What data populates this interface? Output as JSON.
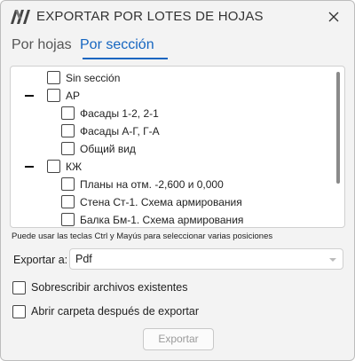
{
  "window": {
    "title": "EXPORTAR POR LOTES DE HOJAS"
  },
  "tabs": [
    {
      "label": "Por hojas",
      "active": false
    },
    {
      "label": "Por sección",
      "active": true
    }
  ],
  "tree": {
    "rows": [
      {
        "label": "Sin sección",
        "level": 1,
        "collapsible": false,
        "checked": false
      },
      {
        "label": "АР",
        "level": 1,
        "collapsible": true,
        "expanded": true,
        "checked": false
      },
      {
        "label": "Фасады 1-2, 2-1",
        "level": 2,
        "collapsible": false,
        "checked": false
      },
      {
        "label": "Фасады А-Г, Г-А",
        "level": 2,
        "collapsible": false,
        "checked": false
      },
      {
        "label": "Общий вид",
        "level": 2,
        "collapsible": false,
        "checked": false
      },
      {
        "label": "КЖ",
        "level": 1,
        "collapsible": true,
        "expanded": true,
        "checked": false
      },
      {
        "label": "Планы на отм. -2,600 и 0,000",
        "level": 2,
        "collapsible": false,
        "checked": false
      },
      {
        "label": "Стена Ст-1. Схема армирования",
        "level": 2,
        "collapsible": false,
        "checked": false
      },
      {
        "label": "Балка Бм-1. Схема армирования",
        "level": 2,
        "collapsible": false,
        "checked": false
      }
    ]
  },
  "hint": "Puede usar las teclas Ctrl y Mayús para seleccionar varias posiciones",
  "export": {
    "label": "Exportar a:",
    "value": "Pdf"
  },
  "options": {
    "overwrite": {
      "label": "Sobrescribir archivos existentes",
      "checked": false
    },
    "open_folder": {
      "label": "Abrir carpeta después de exportar",
      "checked": false
    }
  },
  "actions": {
    "export_button": "Exportar"
  },
  "colors": {
    "accent": "#1565c0",
    "window_bg": "#f3f3f3",
    "disabled_text": "#9a9a9a"
  },
  "icons": {
    "logo": "app-logo-icon",
    "close": "close-icon",
    "dropdown": "chevron-down-icon"
  }
}
